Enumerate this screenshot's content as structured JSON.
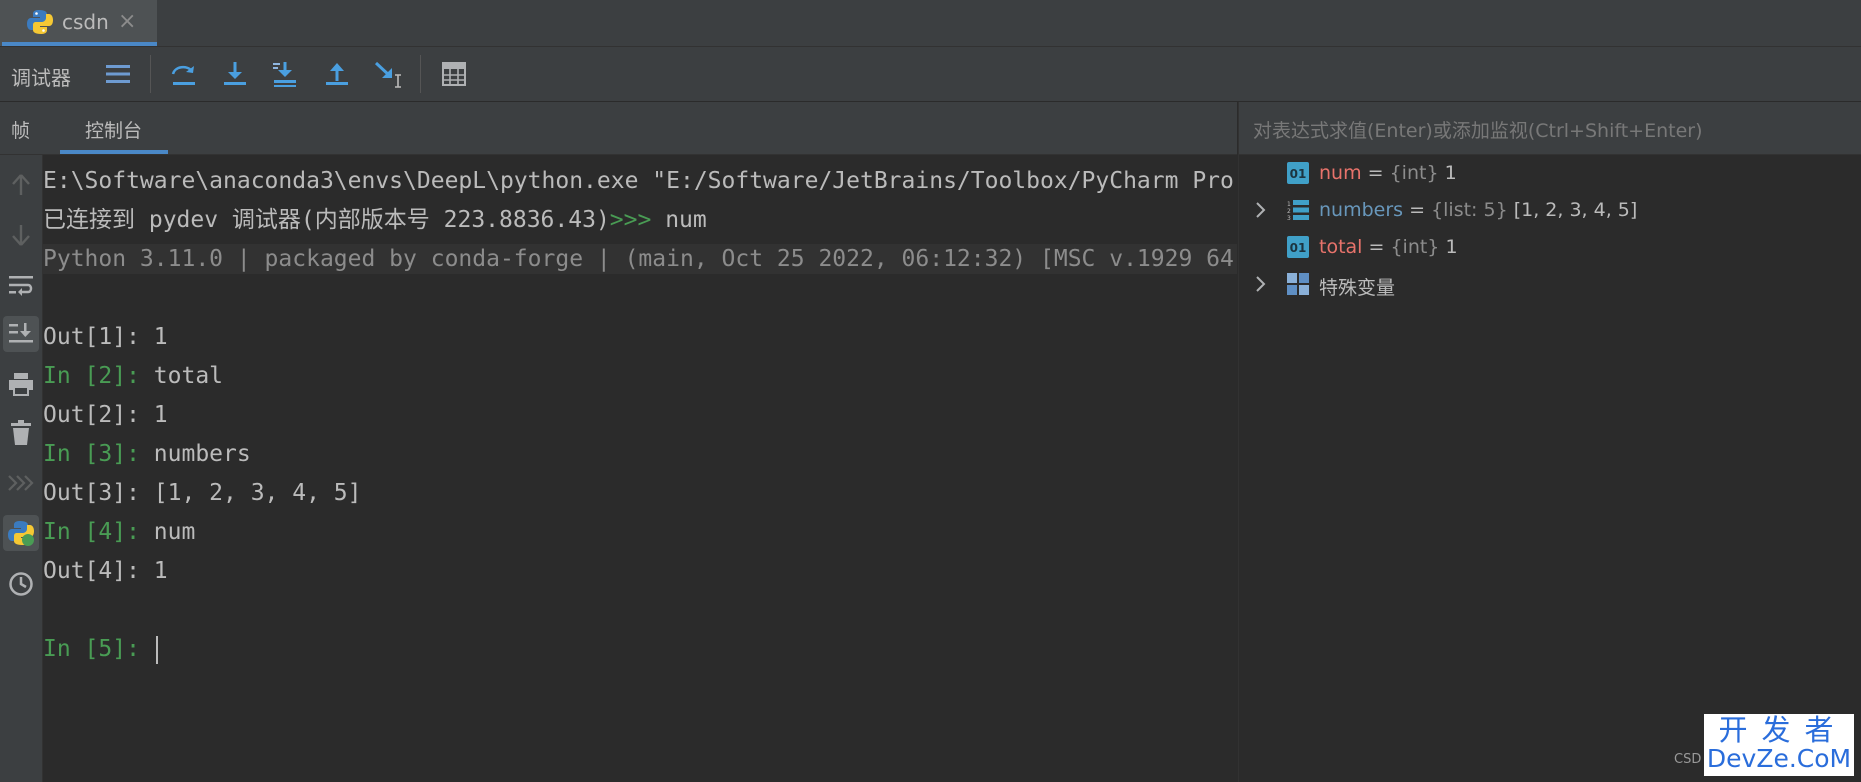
{
  "tab": {
    "title": "csdn",
    "close": "×"
  },
  "toolbar": {
    "label": "调试器"
  },
  "console_tabs": {
    "frames": "帧",
    "console": "控制台"
  },
  "watch": {
    "placeholder": "对表达式求值(Enter)或添加监视(Ctrl+Shift+Enter)"
  },
  "console": {
    "lines": [
      {
        "text": "E:\\Software\\anaconda3\\envs\\DeepL\\python.exe \"E:/Software/JetBrains/Toolbox/PyCharm Pro"
      },
      {
        "text": "已连接到 pydev 调试器(内部版本号 223.8836.43)",
        "prompt": ">>> ",
        "input": "num"
      },
      {
        "text": "Python 3.11.0 | packaged by conda-forge | (main, Oct 25 2022, 06:12:32) [MSC v.1929 64"
      },
      {
        "text": ""
      },
      {
        "text": "Out[1]: 1"
      },
      {
        "prompt": "In [2]: ",
        "input": "total"
      },
      {
        "text": "Out[2]: 1"
      },
      {
        "prompt": "In [3]: ",
        "input": "numbers"
      },
      {
        "text": "Out[3]: [1, 2, 3, 4, 5]"
      },
      {
        "prompt": "In [4]: ",
        "input": "num"
      },
      {
        "text": "Out[4]: 1"
      },
      {
        "text": ""
      },
      {
        "prompt": "In [5]: ",
        "input": ""
      }
    ]
  },
  "variables": [
    {
      "name": "num",
      "eq": " = ",
      "type": "{int} ",
      "value": "1",
      "color": "#e8736b",
      "expandable": false
    },
    {
      "name": "numbers",
      "eq": " = ",
      "type": "{list: 5} ",
      "value": "[1, 2, 3, 4, 5]",
      "color": "#6897bb",
      "expandable": true
    },
    {
      "name": "total",
      "eq": " = ",
      "type": "{int} ",
      "value": "1",
      "color": "#e8736b",
      "expandable": false
    },
    {
      "name": "特殊变量",
      "eq": "",
      "type": "",
      "value": "",
      "color": "#bbbbbb",
      "expandable": true
    }
  ],
  "watermark": {
    "top": "开发者",
    "bottom": "DevZe.CoM",
    "left": "CSD"
  },
  "colors": {
    "accent": "#4a88c7",
    "prompt_green": "#499c54",
    "background": "#2b2b2b",
    "panel": "#3c3f41"
  }
}
